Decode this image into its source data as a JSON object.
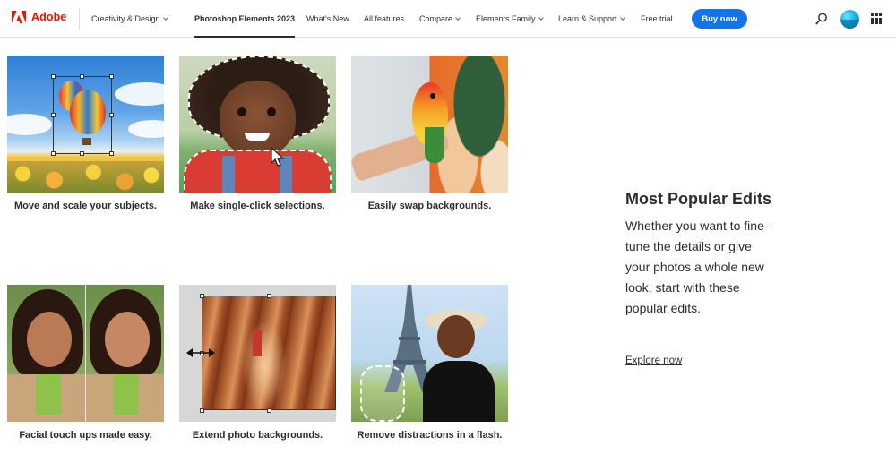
{
  "header": {
    "brand": "Adobe",
    "nav": [
      {
        "label": "Creativity & Design",
        "dropdown": true
      },
      {
        "label": "Photoshop Elements 2023",
        "active": true
      },
      {
        "label": "What's New"
      },
      {
        "label": "All features"
      },
      {
        "label": "Compare",
        "dropdown": true
      },
      {
        "label": "Elements Family",
        "dropdown": true
      },
      {
        "label": "Learn & Support",
        "dropdown": true
      },
      {
        "label": "Free trial"
      }
    ],
    "buy_button": "Buy now",
    "icons": [
      "search-icon",
      "avatar",
      "app-switcher-icon"
    ],
    "colors": {
      "brand_red": "#eb1000",
      "button_blue": "#1473e6"
    }
  },
  "features": [
    {
      "caption": "Move and scale your subjects."
    },
    {
      "caption": "Make single-click selections."
    },
    {
      "caption": "Easily swap backgrounds."
    },
    {
      "caption": "Facial touch ups made easy."
    },
    {
      "caption": "Extend photo backgrounds."
    },
    {
      "caption": "Remove distractions in a flash."
    }
  ],
  "promo": {
    "title": "Most Popular Edits",
    "body": "Whether you want to fine-tune the details or give your photos a whole new look, start with these popular edits.",
    "link": "Explore now"
  }
}
